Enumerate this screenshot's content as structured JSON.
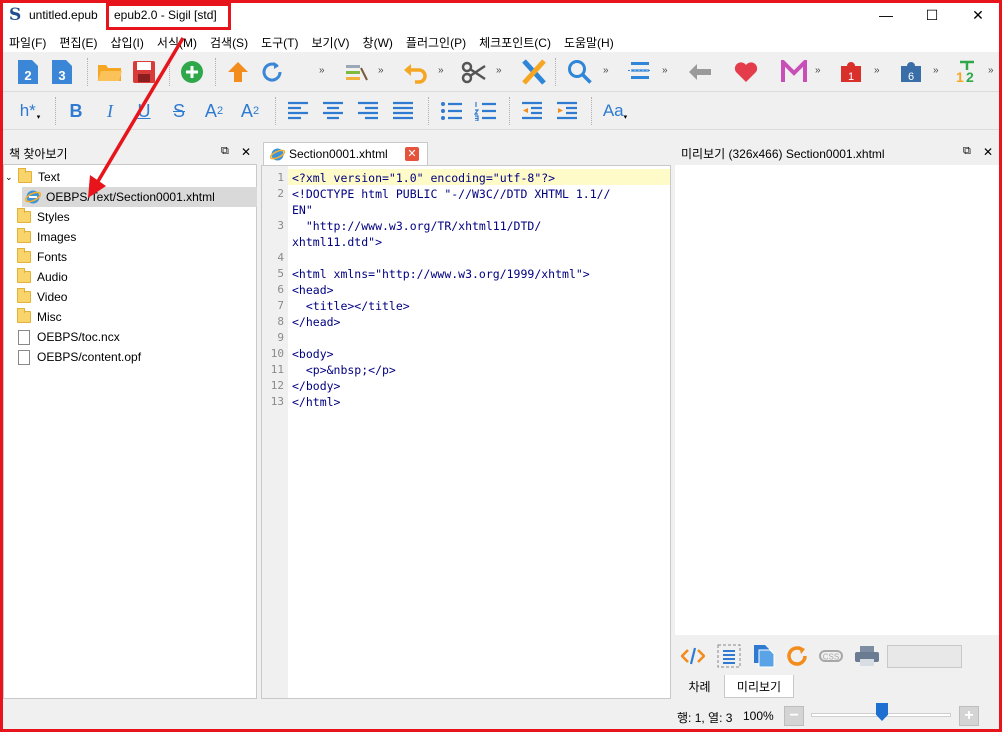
{
  "window": {
    "file_name": "untitled.epub",
    "title_rest": "epub2.0 - Sigil [std]",
    "app_icon_glyph": "S",
    "controls": {
      "minimize": "—",
      "maximize": "☐",
      "close": "✕"
    }
  },
  "menu": [
    "파일(F)",
    "편집(E)",
    "삽입(I)",
    "서식(M)",
    "검색(S)",
    "도구(T)",
    "보기(V)",
    "창(W)",
    "플러그인(P)",
    "체크포인트(C)",
    "도움말(H)"
  ],
  "toolbar2": {
    "heading": "h*",
    "bold": "B",
    "italic": "I",
    "underline": "U",
    "strike": "S",
    "subscript": "A",
    "subscript_digit": "2",
    "superscript": "A",
    "superscript_digit": "2",
    "font": "Aa"
  },
  "toolbar1": {
    "badge_1": "2",
    "badge_2": "3",
    "plugin_badge_1": "1",
    "plugin_badge_2": "6",
    "more": "»"
  },
  "book_browser": {
    "title": "책 찾아보기",
    "tree": [
      {
        "label": "Text",
        "type": "folder",
        "expanded": true
      },
      {
        "label": "OEBPS/Text/Section0001.xhtml",
        "type": "xhtml",
        "selected": true
      },
      {
        "label": "Styles",
        "type": "folder"
      },
      {
        "label": "Images",
        "type": "folder"
      },
      {
        "label": "Fonts",
        "type": "folder"
      },
      {
        "label": "Audio",
        "type": "folder"
      },
      {
        "label": "Video",
        "type": "folder"
      },
      {
        "label": "Misc",
        "type": "folder"
      },
      {
        "label": "OEBPS/toc.ncx",
        "type": "file"
      },
      {
        "label": "OEBPS/content.opf",
        "type": "file"
      }
    ]
  },
  "editor": {
    "tab_label": "Section0001.xhtml",
    "line_numbers": [
      "1",
      "2",
      "3",
      "4",
      "5",
      "6",
      "7",
      "8",
      "9",
      "10",
      "11",
      "12",
      "13"
    ],
    "lines": [
      "<?xml version=\"1.0\" encoding=\"utf-8\"?>",
      "<!DOCTYPE html PUBLIC \"-//W3C//DTD XHTML 1.1//",
      "EN\"",
      "  \"http://www.w3.org/TR/xhtml11/DTD/",
      "xhtml11.dtd\">",
      "",
      "<html xmlns=\"http://www.w3.org/1999/xhtml\">",
      "<head>",
      "  <title></title>",
      "</head>",
      "",
      "<body>",
      "  <p>&nbsp;</p>",
      "</body>",
      "</html>"
    ]
  },
  "preview": {
    "title": "미리보기 (326x466) Section0001.xhtml",
    "tabs": [
      "차례",
      "미리보기"
    ],
    "active_tab": "미리보기"
  },
  "status": {
    "position": "행: 1, 열: 3",
    "zoom": "100%",
    "zoom_out": "−",
    "zoom_in": "+"
  },
  "annotation_color": "#e8141b"
}
